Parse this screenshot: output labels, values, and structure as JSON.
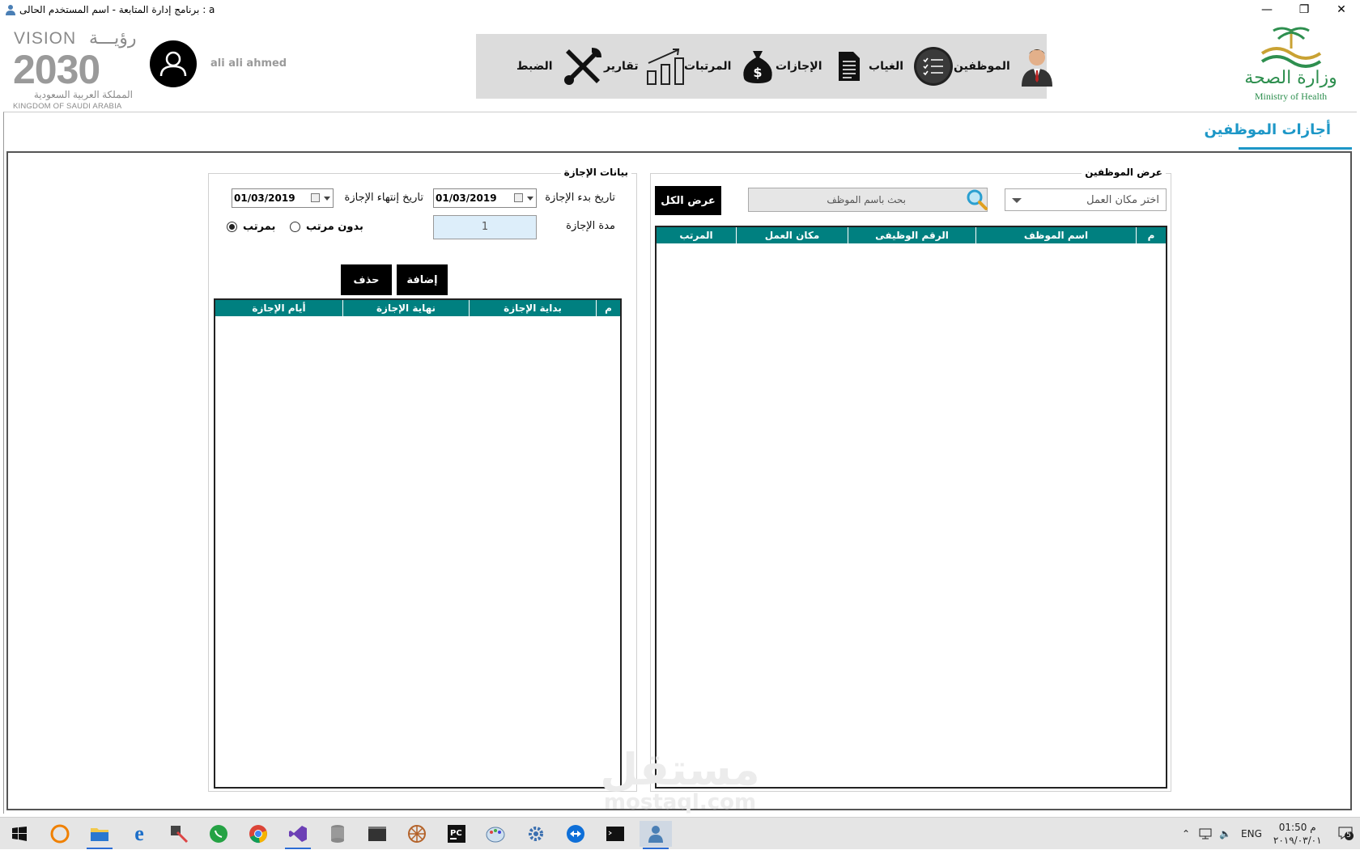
{
  "window": {
    "title": "برنامج إدارة المتابعة  -  اسم المستخدم الحالى  :  a",
    "controls": {
      "minimize": "—",
      "restore": "❐",
      "close": "✕"
    }
  },
  "header": {
    "vision": {
      "line1": "VISION",
      "line1_ar": "رؤيـــة",
      "year": "2030",
      "kingdom_ar": "المملكة العربية السعودية",
      "kingdom_en": "KINGDOM OF SAUDI ARABIA"
    },
    "username": "ali ali ahmed",
    "nav": [
      {
        "key": "employees",
        "label": "الموظفين",
        "icon": "employee-icon"
      },
      {
        "key": "absence",
        "label": "الغياب",
        "icon": "checklist-icon"
      },
      {
        "key": "leaves",
        "label": "الإجازات",
        "icon": "document-icon"
      },
      {
        "key": "salaries",
        "label": "المرتبات",
        "icon": "money-bag-icon"
      },
      {
        "key": "reports",
        "label": "تقارير",
        "icon": "bar-chart-icon"
      },
      {
        "key": "settings",
        "label": "الضبط",
        "icon": "tools-icon"
      }
    ],
    "ministry": {
      "ar": "وزارة الصحة",
      "en": "Ministry of Health"
    }
  },
  "page": {
    "title": "أجازات الموظفين"
  },
  "employees_panel": {
    "title": "عرض الموظفين",
    "workplace_placeholder": "اختر مكان العمل",
    "search_placeholder": "بحث باسم الموظف",
    "show_all": "عرض الكل",
    "columns": [
      "م",
      "اسم الموظف",
      "الرقم الوظيفى",
      "مكان العمل",
      "المرتب"
    ],
    "rows": []
  },
  "leave_panel": {
    "title": "بيانات الإجازة",
    "start_label": "تاريخ بدء الإجازة",
    "start_value": "01/03/2019",
    "end_label": "تاريخ إنتهاء الإجازة",
    "end_value": "01/03/2019",
    "duration_label": "مدة الإجازة",
    "duration_value": "1",
    "without_salary": "بدون مرتب",
    "with_salary": "بمرتب",
    "selected_option": "with_salary",
    "add": "إضافة",
    "delete": "حذف",
    "columns": [
      "م",
      "بداية الإجازة",
      "نهاية الإجازة",
      "أيام الإجازة"
    ],
    "rows": []
  },
  "watermark": {
    "line1": "مستقل",
    "line2": "mostaql.com"
  },
  "taskbar": {
    "apps": [
      "windows-start-icon",
      "eclipse-icon",
      "file-explorer-icon",
      "edge-icon",
      "tools-app-icon",
      "whatsapp-icon",
      "chrome-icon",
      "visual-studio-icon",
      "database-icon",
      "terminal-icon",
      "network-icon",
      "pycharm-icon",
      "paint-icon",
      "settings-app-icon",
      "teamviewer-icon",
      "cmd-icon",
      "active-app-icon"
    ],
    "language": "ENG",
    "time": "01:50 م",
    "date": "٢٠١٩/٠٣/٠١",
    "notifications": "5"
  }
}
